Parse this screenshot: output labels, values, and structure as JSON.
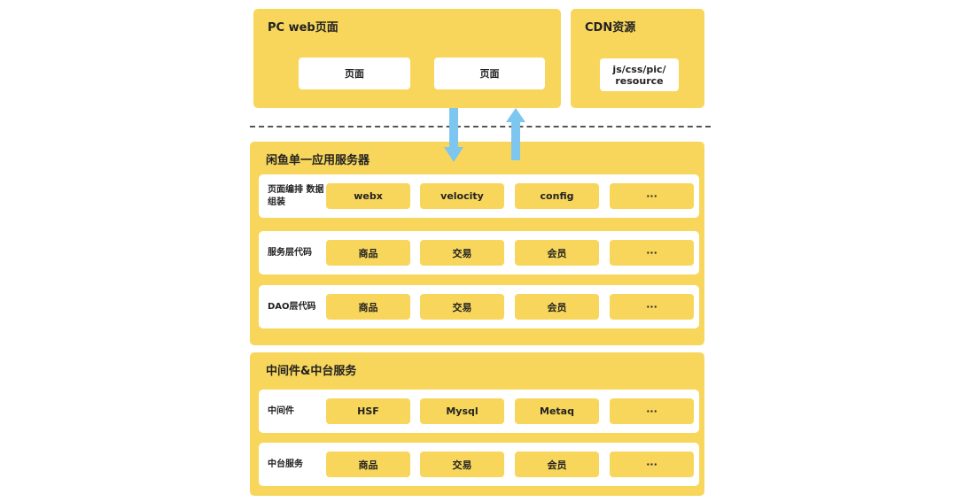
{
  "pc_web": {
    "title": "PC web页面",
    "pages": [
      "页面",
      "页面"
    ]
  },
  "cdn": {
    "title": "CDN资源",
    "resource": "js/css/pic/ resource"
  },
  "server": {
    "title": "闲鱼单一应用服务器",
    "rows": [
      {
        "label": "页面编排 数据组装",
        "cells": [
          "webx",
          "velocity",
          "config",
          "···"
        ]
      },
      {
        "label": "服务层代码",
        "cells": [
          "商品",
          "交易",
          "会员",
          "···"
        ]
      },
      {
        "label": "DAO层代码",
        "cells": [
          "商品",
          "交易",
          "会员",
          "···"
        ]
      }
    ]
  },
  "middleware": {
    "title": "中间件&中台服务",
    "rows": [
      {
        "label": "中间件",
        "cells": [
          "HSF",
          "Mysql",
          "Metaq",
          "···"
        ]
      },
      {
        "label": "中台服务",
        "cells": [
          "商品",
          "交易",
          "会员",
          "···"
        ]
      }
    ]
  },
  "colors": {
    "box": "#f8d65c",
    "arrow": "#7cc6f0"
  }
}
